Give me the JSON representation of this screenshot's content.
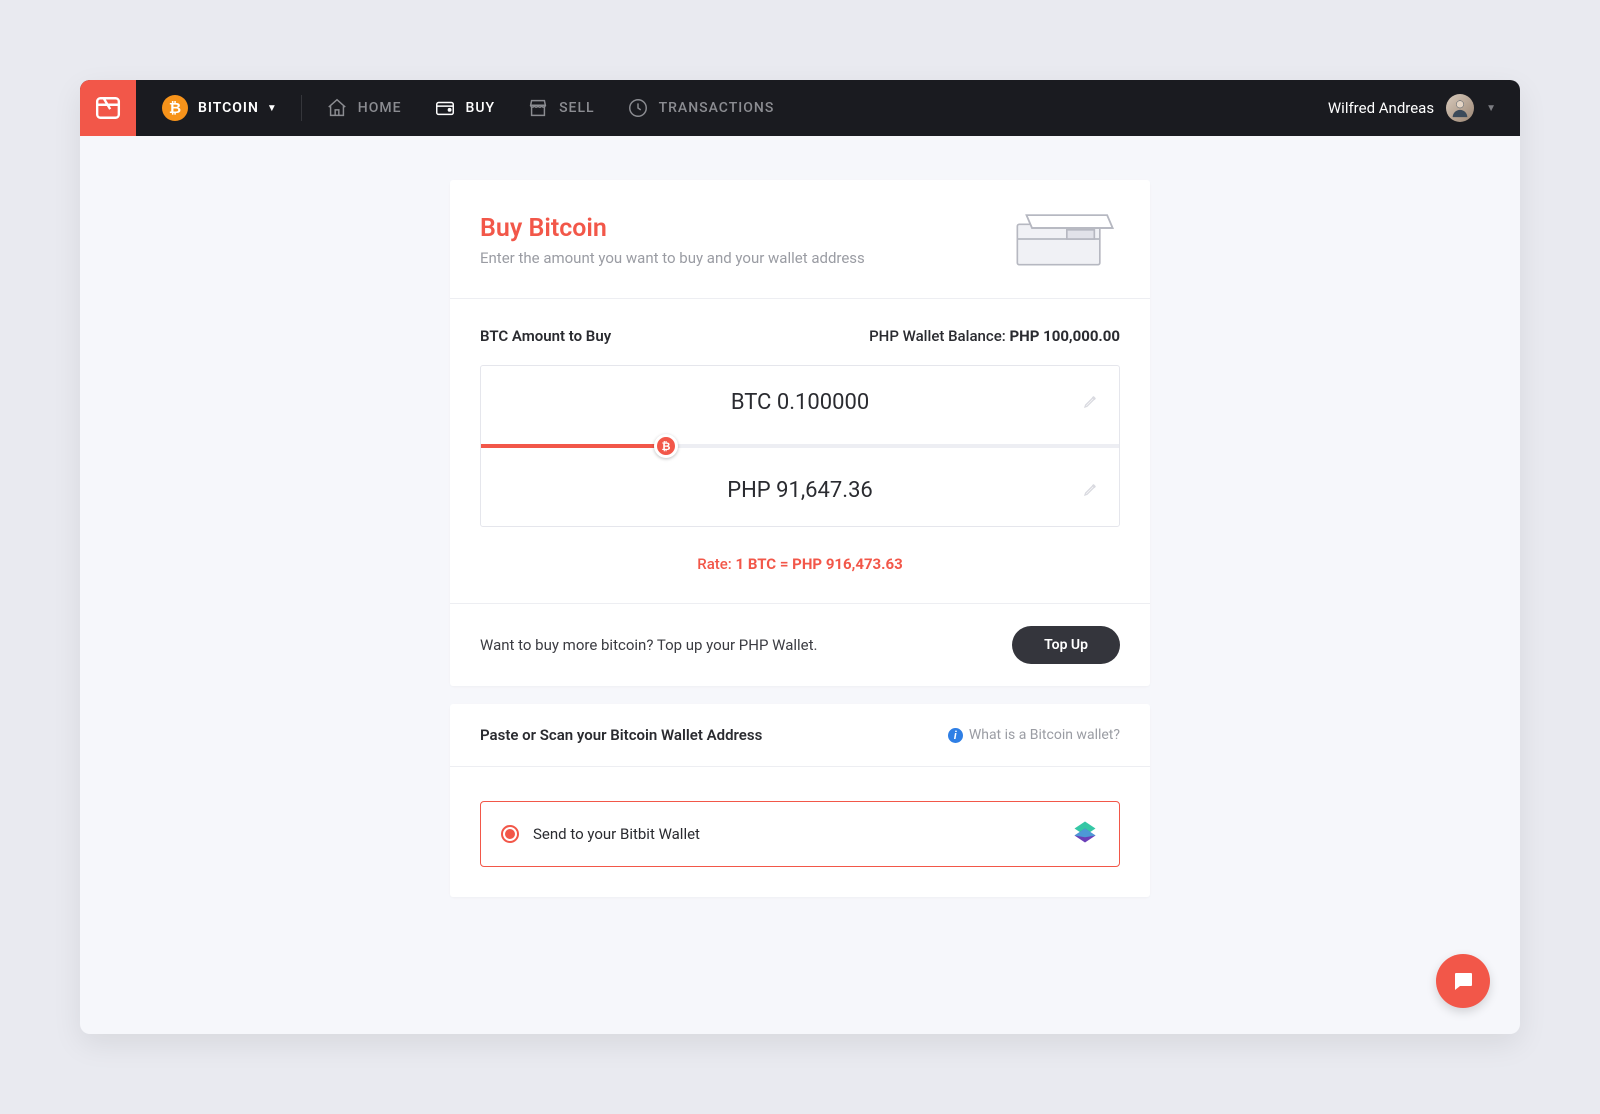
{
  "header": {
    "currency_label": "BITCOIN",
    "user_name": "Wilfred Andreas"
  },
  "nav": {
    "home": "HOME",
    "buy": "BUY",
    "sell": "SELL",
    "transactions": "TRANSACTIONS"
  },
  "buy": {
    "title": "Buy Bitcoin",
    "subtitle": "Enter the amount you want to buy and your wallet address",
    "amount_label": "BTC Amount to Buy",
    "balance_label": "PHP Wallet Balance: ",
    "balance_value": "PHP 100,000.00",
    "btc_value": "BTC 0.100000",
    "php_value": "PHP 91,647.36",
    "rate_label": "Rate: ",
    "rate_value": "1 BTC = PHP 916,473.63",
    "slider_percent": 29,
    "topup_text": "Want to buy more bitcoin? Top up your PHP Wallet.",
    "topup_button": "Top Up"
  },
  "wallet": {
    "section_title": "Paste or Scan your Bitcoin Wallet Address",
    "info_link": "What is a Bitcoin wallet?",
    "option_label": "Send to your Bitbit Wallet"
  }
}
